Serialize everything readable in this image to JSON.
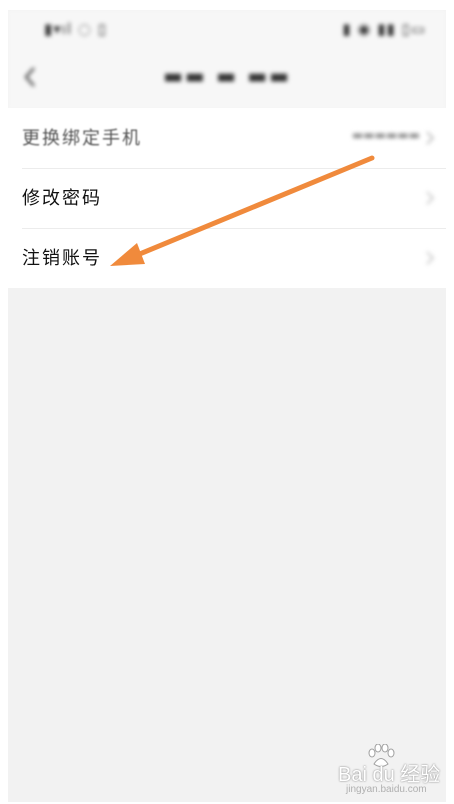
{
  "list": {
    "items": [
      {
        "label": "更换绑定手机"
      },
      {
        "label": "修改密码"
      },
      {
        "label": "注销账号"
      }
    ]
  },
  "annotation": {
    "arrow_color": "#f08a3c"
  },
  "watermark": {
    "brand": "Bai du 经验",
    "url": "jingyan.baidu.com"
  }
}
